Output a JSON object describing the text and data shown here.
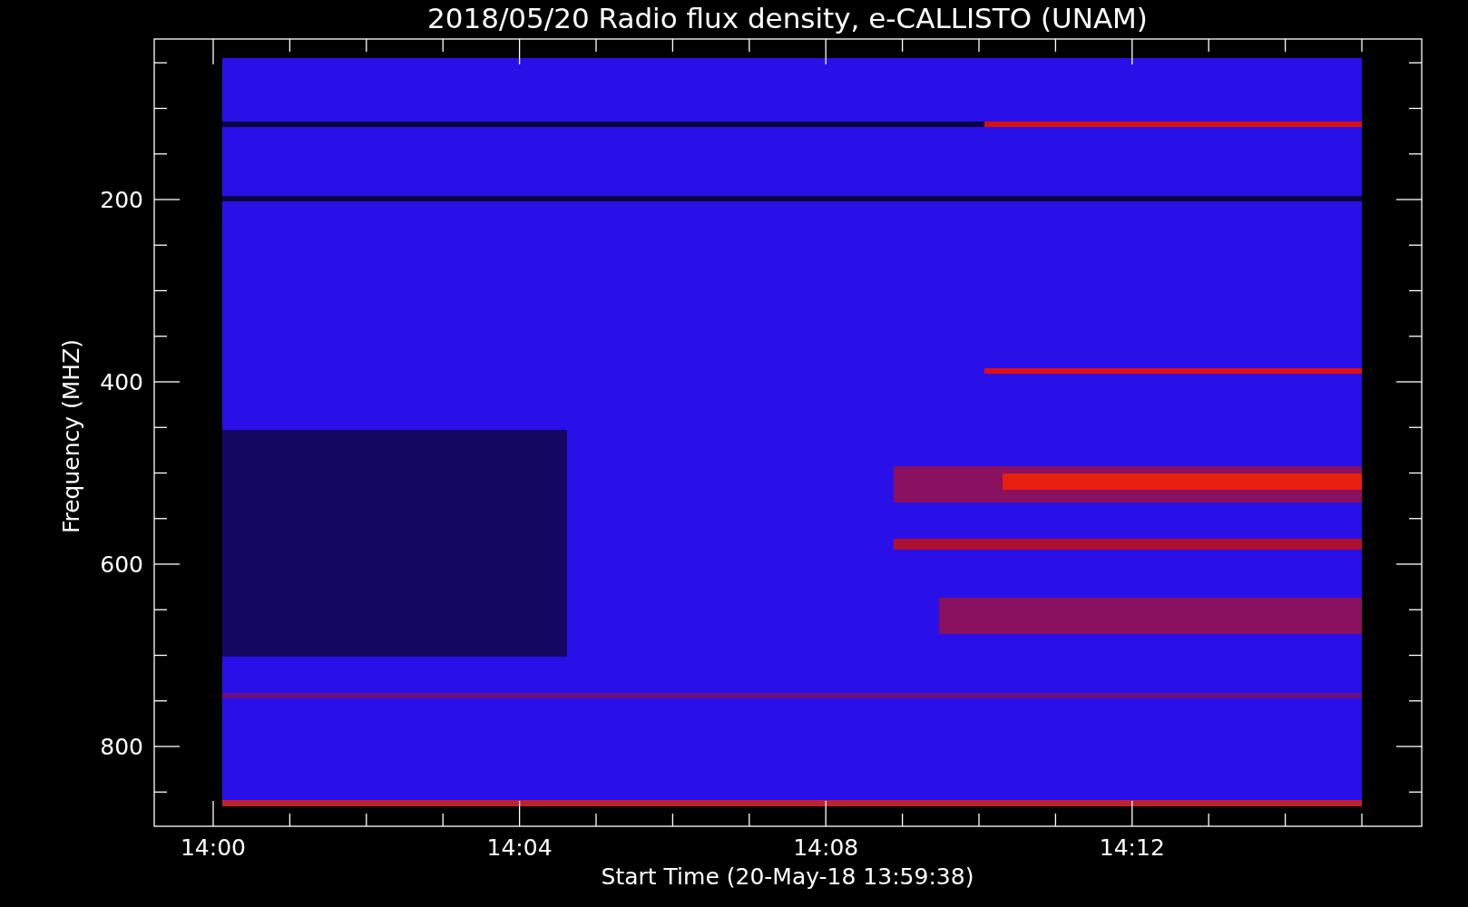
{
  "title": "2018/05/20  Radio flux density, e-CALLISTO (UNAM)",
  "plot": {
    "ylabel": "Frequency (MHZ)",
    "xlabel": "Start Time (20-May-18 13:59:38)",
    "yticks": [
      "200",
      "400",
      "600",
      "800"
    ],
    "xticks": [
      "14:00",
      "14:04",
      "14:08",
      "14:12"
    ]
  }
}
